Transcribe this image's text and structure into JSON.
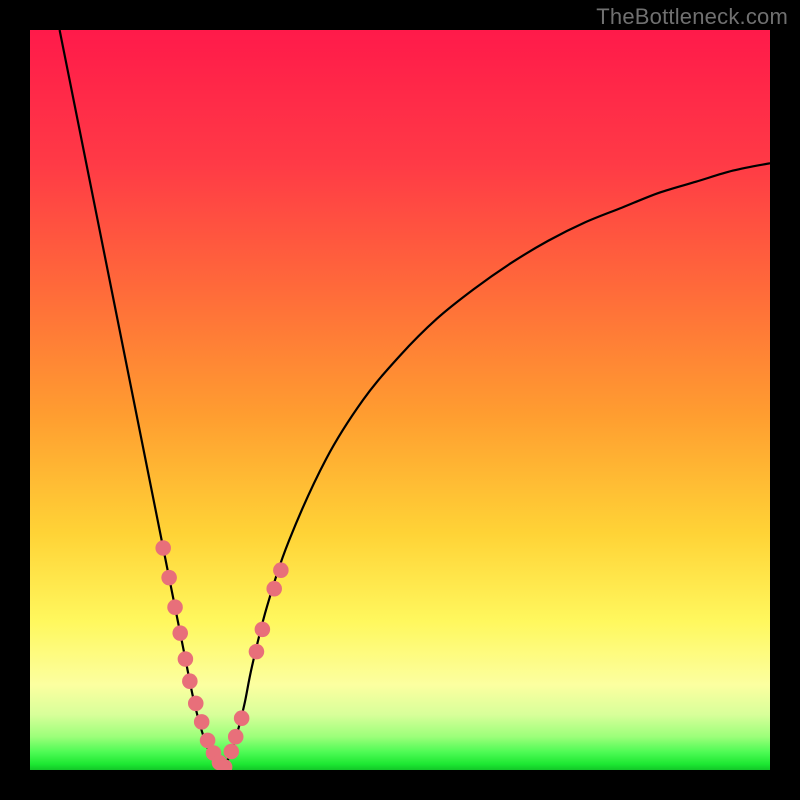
{
  "watermark": "TheBottleneck.com",
  "chart_data": {
    "type": "line",
    "title": "",
    "xlabel": "",
    "ylabel": "",
    "xlim": [
      0,
      100
    ],
    "ylim": [
      0,
      100
    ],
    "grid": false,
    "background": "red-yellow-green vertical gradient (red top, green bottom)",
    "series": [
      {
        "name": "left-branch",
        "x": [
          4,
          6,
          8,
          10,
          12,
          14,
          16,
          18,
          20,
          21,
          22,
          23,
          24,
          25,
          26
        ],
        "y": [
          100,
          90,
          80,
          70,
          60,
          50,
          40,
          30,
          20,
          15,
          10,
          6,
          3,
          1,
          0
        ]
      },
      {
        "name": "right-branch",
        "x": [
          26,
          27,
          28,
          29,
          30,
          32,
          35,
          40,
          45,
          50,
          55,
          60,
          65,
          70,
          75,
          80,
          85,
          90,
          95,
          100
        ],
        "y": [
          0,
          2,
          5,
          9,
          14,
          22,
          31,
          42,
          50,
          56,
          61,
          65,
          68.5,
          71.5,
          74,
          76,
          78,
          79.5,
          81,
          82
        ]
      }
    ],
    "markers": [
      {
        "name": "left-dots",
        "x": [
          18.0,
          18.8,
          19.6,
          20.3,
          21.0,
          21.6,
          22.4,
          23.2,
          24.0,
          24.8,
          25.6,
          26.3
        ],
        "y": [
          30.0,
          26.0,
          22.0,
          18.5,
          15.0,
          12.0,
          9.0,
          6.5,
          4.0,
          2.3,
          1.0,
          0.4
        ]
      },
      {
        "name": "right-dots",
        "x": [
          27.2,
          27.8,
          28.6,
          30.6,
          31.4,
          33.0,
          33.9
        ],
        "y": [
          2.5,
          4.5,
          7.0,
          16.0,
          19.0,
          24.5,
          27.0
        ]
      }
    ]
  },
  "colors": {
    "marker": "#e86f7a",
    "curve": "#000000",
    "green": "#18dd33",
    "greenBright": "#2cff40",
    "greenPale": "#b8ff8a",
    "yellowPale": "#fcffa0",
    "yellow": "#ffe13a",
    "orange": "#ff9d30",
    "redOrange": "#ff6a3a",
    "red": "#ff1a4a"
  }
}
